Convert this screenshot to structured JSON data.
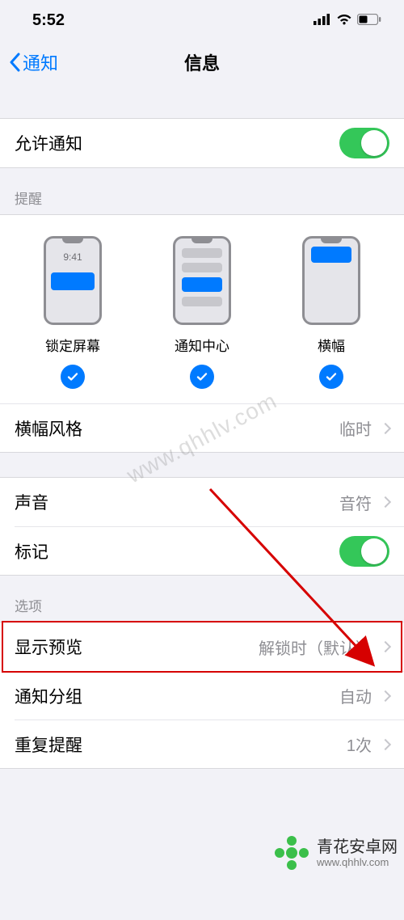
{
  "status_bar": {
    "time": "5:52"
  },
  "nav": {
    "back_label": "通知",
    "title": "信息"
  },
  "allow_notifications": {
    "label": "允许通知",
    "on": true
  },
  "alerts": {
    "header": "提醒",
    "options": [
      {
        "label": "锁定屏幕",
        "checked": true
      },
      {
        "label": "通知中心",
        "checked": true
      },
      {
        "label": "横幅",
        "checked": true
      }
    ],
    "lock_time": "9:41",
    "banner_style": {
      "label": "横幅风格",
      "value": "临时"
    }
  },
  "sound": {
    "label": "声音",
    "value": "音符"
  },
  "badges": {
    "label": "标记",
    "on": true
  },
  "options": {
    "header": "选项",
    "show_previews": {
      "label": "显示预览",
      "value": "解锁时（默认）"
    },
    "grouping": {
      "label": "通知分组",
      "value": "自动"
    },
    "repeat_alerts": {
      "label": "重复提醒",
      "value": "1次"
    }
  },
  "annotation": {
    "arrow_color": "#d60000"
  },
  "watermark": {
    "diagonal_text": "www.qhhlv.com",
    "brand_name": "青花安卓网",
    "brand_url": "www.qhhlv.com"
  }
}
